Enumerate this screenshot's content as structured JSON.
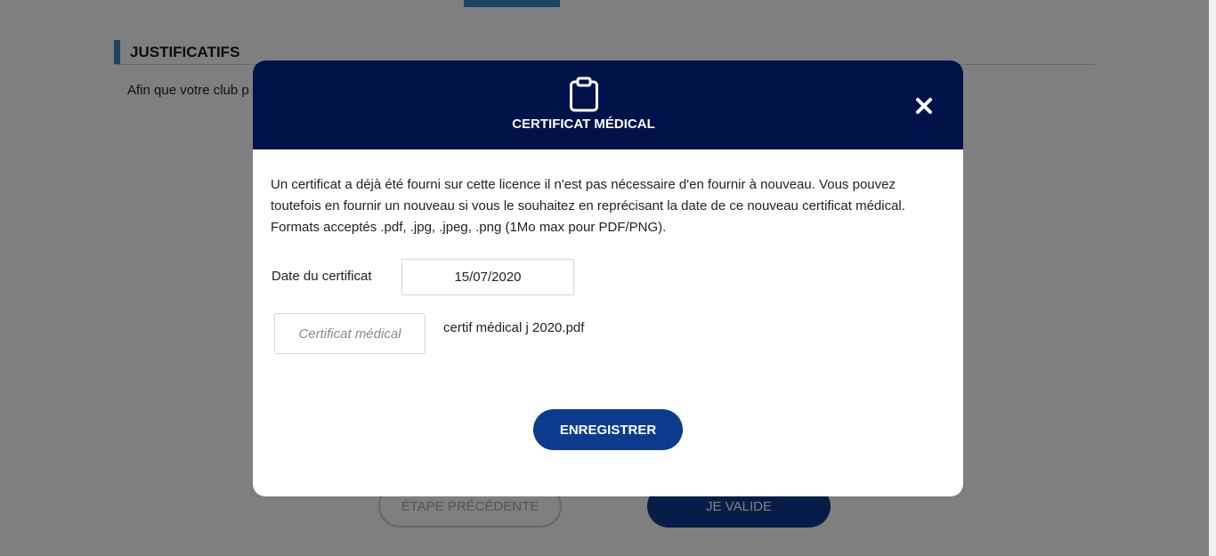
{
  "background": {
    "section_title": "JUSTIFICATIFS",
    "intro_text": "Afin que votre club p",
    "prev_button": "ÉTAPE PRÉCÉDENTE",
    "valid_button": "JE VALIDE"
  },
  "modal": {
    "title": "CERTIFICAT MÉDICAL",
    "header_icon": "clipboard-icon",
    "close_icon": "close-icon",
    "description": "Un certificat a déjà été fourni sur cette licence il n'est pas nécessaire d'en fournir à nouveau. Vous pouvez toutefois en fournir un nouveau si vous le souhaitez en reprécisant la date de ce nouveau certificat médical. Formats acceptés .pdf, .jpg, .jpeg, .png (1Mo max pour PDF/PNG).",
    "date_label": "Date du certificat",
    "date_value": "15/07/2020",
    "cert_button": "Certificat médical",
    "file_name": "certif médical j 2020.pdf",
    "save_button": "ENREGISTRER"
  },
  "colors": {
    "header": "#00124a",
    "primary_button": "#0b3a8f",
    "accent": "#3b8bc2"
  }
}
